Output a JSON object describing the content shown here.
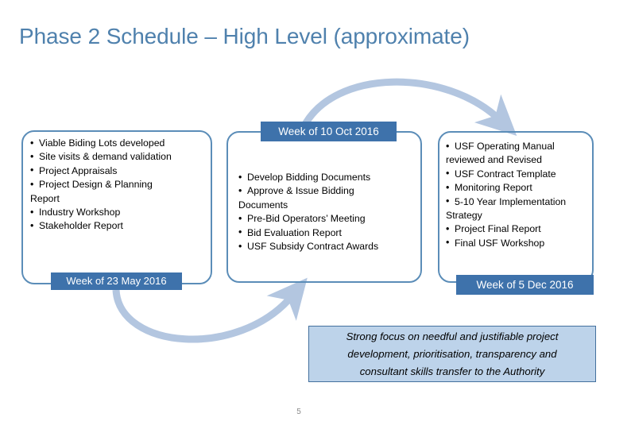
{
  "slide": {
    "title": "Phase 2 Schedule – High Level (approximate)",
    "page_number": "5",
    "colors": {
      "title_blue": "#4f81ad",
      "box_border_blue": "#5b8db8",
      "badge_blue": "#3e72ab",
      "arrow_blue": "#b3c6e0",
      "callout_fill": "#bdd3ea",
      "callout_border": "#44709e",
      "page_number_gray": "#8a8a8a"
    }
  },
  "phases": [
    {
      "id": "phase-1",
      "date_label": "Week of 23 May 2016",
      "items": [
        "Viable Biding Lots developed",
        "Site visits & demand validation",
        "Project Appraisals",
        "Project Design & Planning",
        "Report",
        "Industry Workshop",
        "Stakeholder Report"
      ]
    },
    {
      "id": "phase-2",
      "date_label": "Week of 10 Oct 2016",
      "items": [
        "Develop Bidding Documents",
        "Approve & Issue Bidding",
        "Documents",
        "Pre-Bid Operators’ Meeting",
        "Bid Evaluation Report",
        "USF Subsidy Contract Awards"
      ]
    },
    {
      "id": "phase-3",
      "date_label": "Week of 5 Dec 2016",
      "items": [
        "USF Operating Manual",
        "reviewed and Revised",
        "USF Contract Template",
        "Monitoring Report",
        "5-10 Year Implementation",
        "Strategy",
        "Project Final Report",
        "Final USF Workshop"
      ]
    }
  ],
  "callout": {
    "line1": "Strong focus on needful and justifiable project",
    "line2": "development, prioritisation, transparency and",
    "line3": "consultant skills transfer to the Authority"
  },
  "arrows": [
    {
      "name": "arrow-phase2-to-phase3",
      "from": "phase-2",
      "to": "phase-3",
      "direction": "right"
    },
    {
      "name": "arrow-phase1-to-phase2",
      "from": "phase-1",
      "to": "phase-2",
      "direction": "right"
    }
  ]
}
